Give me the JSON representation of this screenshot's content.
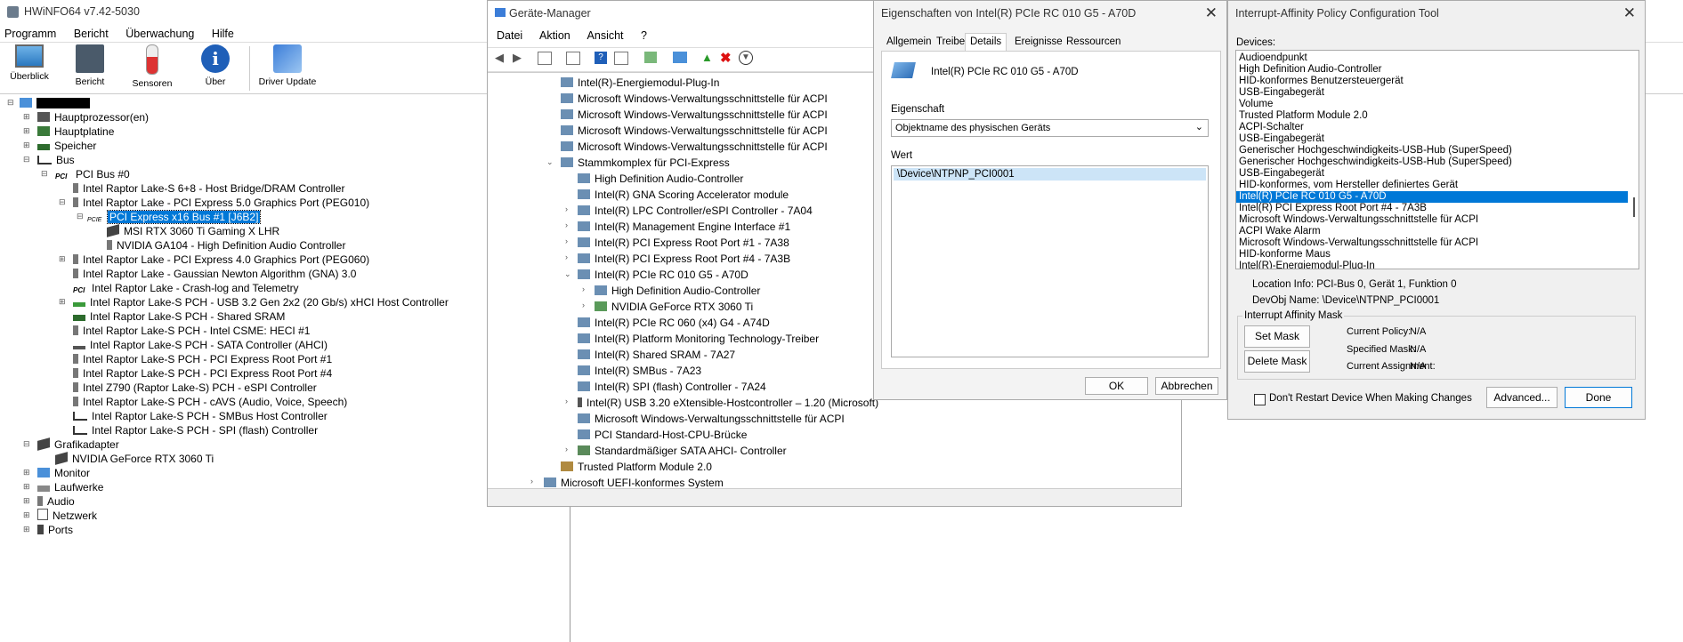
{
  "hwinfo": {
    "title": "HWiNFO64 v7.42-5030",
    "menu": [
      "Programm",
      "Bericht",
      "Überwachung",
      "Hilfe"
    ],
    "toolbar": [
      "Überblick",
      "Bericht",
      "Sensoren",
      "Über",
      "Driver Update"
    ],
    "tree": [
      "Hauptprozessor(en)",
      "Hauptplatine",
      "Speicher",
      "Bus",
      "PCI Bus #0",
      "Intel Raptor Lake-S 6+8 - Host Bridge/DRAM Controller",
      "Intel Raptor Lake - PCI Express 5.0 Graphics Port (PEG010)",
      "PCI Express x16 Bus #1 [J6B2]",
      "MSI RTX 3060 Ti Gaming X LHR",
      "NVIDIA GA104 - High Definition Audio Controller",
      "Intel Raptor Lake - PCI Express 4.0 Graphics Port (PEG060)",
      "Intel Raptor Lake - Gaussian Newton Algorithm (GNA) 3.0",
      "Intel Raptor Lake - Crash-log and Telemetry",
      "Intel Raptor Lake-S PCH - USB 3.2 Gen 2x2 (20 Gb/s) xHCI Host Controller",
      "Intel Raptor Lake-S PCH - Shared SRAM",
      "Intel Raptor Lake-S PCH - Intel CSME: HECI #1",
      "Intel Raptor Lake-S PCH - SATA Controller (AHCI)",
      "Intel Raptor Lake-S PCH - PCI Express Root Port #1",
      "Intel Raptor Lake-S PCH - PCI Express Root Port #4",
      "Intel Z790 (Raptor Lake-S) PCH - eSPI Controller",
      "Intel Raptor Lake-S PCH - cAVS (Audio, Voice, Speech)",
      "Intel Raptor Lake-S PCH - SMBus Host Controller",
      "Intel Raptor Lake-S PCH - SPI (flash) Controller",
      "Grafikadapter",
      "NVIDIA GeForce RTX 3060 Ti",
      "Monitor",
      "Laufwerke",
      "Audio",
      "Netzwerk",
      "Ports"
    ]
  },
  "devmgr": {
    "title": "Geräte-Manager",
    "menu": [
      "Datei",
      "Aktion",
      "Ansicht",
      "?"
    ],
    "tree": [
      "Intel(R)-Energiemodul-Plug-In",
      "Microsoft Windows-Verwaltungsschnittstelle für ACPI",
      "Microsoft Windows-Verwaltungsschnittstelle für ACPI",
      "Microsoft Windows-Verwaltungsschnittstelle für ACPI",
      "Microsoft Windows-Verwaltungsschnittstelle für ACPI",
      "Stammkomplex für PCI-Express",
      "High Definition Audio-Controller",
      "Intel(R) GNA Scoring Accelerator module",
      "Intel(R) LPC Controller/eSPI Controller - 7A04",
      "Intel(R) Management Engine Interface #1",
      "Intel(R) PCI Express Root Port #1 - 7A38",
      "Intel(R) PCI Express Root Port #4 - 7A3B",
      "Intel(R) PCIe RC 010 G5 - A70D",
      "High Definition Audio-Controller",
      "NVIDIA GeForce RTX 3060 Ti",
      "Intel(R) PCIe RC 060 (x4) G4 - A74D",
      "Intel(R) Platform Monitoring Technology-Treiber",
      "Intel(R) Shared SRAM - 7A27",
      "Intel(R) SMBus - 7A23",
      "Intel(R) SPI (flash) Controller - 7A24",
      "Intel(R) USB 3.20 eXtensible-Hostcontroller – 1.20 (Microsoft)",
      "Microsoft Windows-Verwaltungsschnittstelle für ACPI",
      "PCI Standard-Host-CPU-Brücke",
      "Standardmäßiger SATA AHCI- Controller",
      "Trusted Platform Module 2.0",
      "Microsoft UEFI-konformes System"
    ]
  },
  "props": {
    "title": "Eigenschaften von Intel(R) PCIe RC 010 G5 - A70D",
    "tabs": [
      "Allgemein",
      "Treiber",
      "Details",
      "Ereignisse",
      "Ressourcen"
    ],
    "device_name": "Intel(R) PCIe RC 010 G5 - A70D",
    "property_label": "Eigenschaft",
    "property_value": "Objektname des physischen Geräts",
    "value_label": "Wert",
    "value": "\\Device\\NTPNP_PCI0001",
    "ok": "OK",
    "cancel": "Abbrechen"
  },
  "affinity": {
    "title": "Interrupt-Affinity Policy Configuration Tool",
    "devices_label": "Devices:",
    "devices": [
      "Audioendpunkt",
      "High Definition Audio-Controller",
      "HID-konformes Benutzersteuergerät",
      "USB-Eingabegerät",
      "Volume",
      "Trusted Platform Module 2.0",
      "ACPI-Schalter",
      "USB-Eingabegerät",
      "Generischer Hochgeschwindigkeits-USB-Hub (SuperSpeed)",
      "Generischer Hochgeschwindigkeits-USB-Hub (SuperSpeed)",
      "USB-Eingabegerät",
      "HID-konformes, vom Hersteller definiertes Gerät",
      "Intel(R) PCIe RC 010 G5 - A70D",
      "Intel(R) PCI Express Root Port #4 - 7A3B",
      "Microsoft Windows-Verwaltungsschnittstelle für ACPI",
      "ACPI Wake Alarm",
      "Microsoft Windows-Verwaltungsschnittstelle für ACPI",
      "HID-konforme Maus",
      "Intel(R)-Energiemodul-Plug-In"
    ],
    "location": "Location Info: PCI-Bus 0, Gerät 1, Funktion 0",
    "devobj": "DevObj Name: \\Device\\NTPNP_PCI0001",
    "group_label": "Interrupt Affinity Mask",
    "set_mask": "Set Mask",
    "delete_mask": "Delete Mask",
    "current_policy_label": "Current Policy:",
    "current_policy": "N/A",
    "specified_mask_label": "Specified Mask:",
    "specified_mask": "N/A",
    "current_assignment_label": "Current Assignment:",
    "current_assignment": "N/A",
    "dont_restart": "Don't Restart Device When Making Changes",
    "advanced": "Advanced...",
    "done": "Done"
  }
}
